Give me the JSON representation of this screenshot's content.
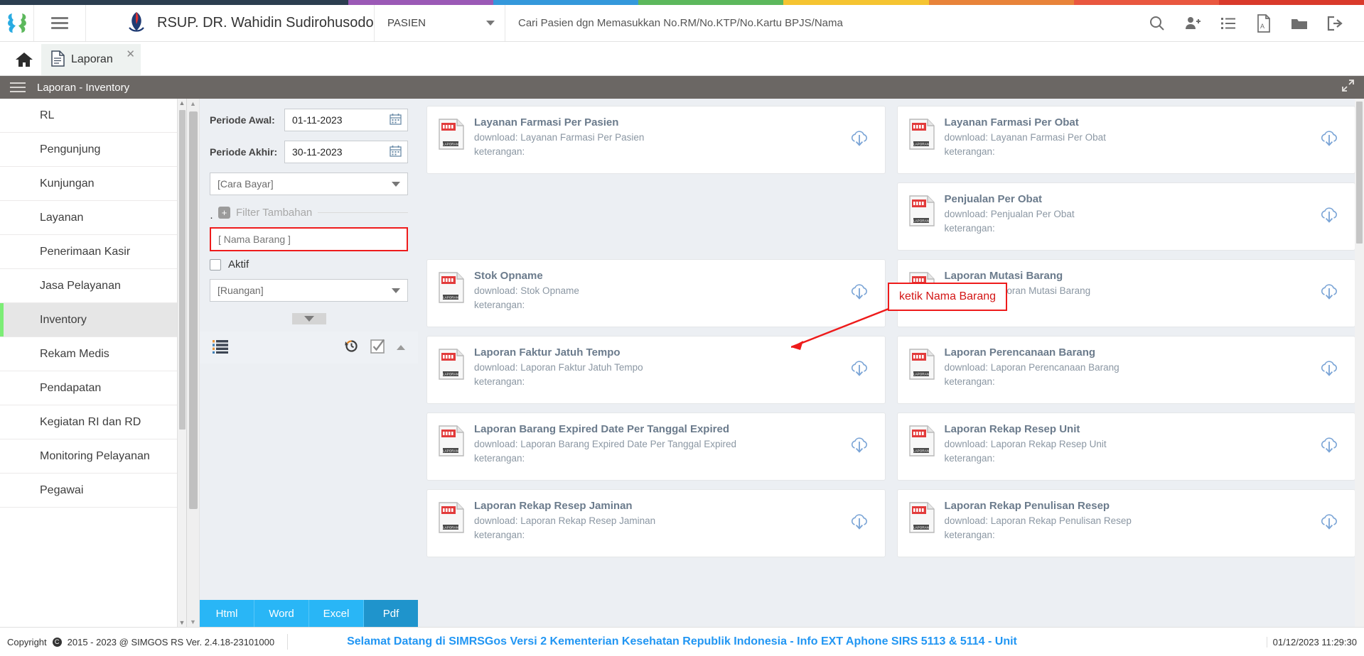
{
  "color_strip": [
    "#2c3e50",
    "#9b59b6",
    "#3498db",
    "#5cb85c",
    "#f5c431",
    "#e8833a",
    "#e9573f",
    "#d93a2b"
  ],
  "header": {
    "logo_icon": "simrs-logo-icon",
    "menu_icon": "hamburger-icon",
    "hospital_icon": "hospital-logo-icon",
    "hospital_name": "RSUP. DR. Wahidin Sudirohusodo",
    "category_select": "PASIEN",
    "search_placeholder": "Cari Pasien dgn Memasukkan No.RM/No.KTP/No.Kartu BPJS/Nama",
    "icons": [
      {
        "name": "search-icon",
        "label": "Cari"
      },
      {
        "name": "add-user-icon",
        "label": "Tambah Pasien"
      },
      {
        "name": "list-icon",
        "label": "Daftar"
      },
      {
        "name": "pdf-icon",
        "label": "PDF"
      },
      {
        "name": "folder-icon",
        "label": "Folder"
      },
      {
        "name": "logout-icon",
        "label": "Keluar"
      }
    ]
  },
  "tabstrip": {
    "home_icon": "home-icon",
    "tabs": [
      {
        "label": "Laporan",
        "icon": "document-icon",
        "close": "✕",
        "active": true
      }
    ]
  },
  "breadcrumb": {
    "menu_icon": "hamburger-icon",
    "title": "Laporan - Inventory",
    "expand_icon": "expand-arrows-icon"
  },
  "sidebar": {
    "items": [
      {
        "label": "RL",
        "active": false
      },
      {
        "label": "Pengunjung",
        "active": false
      },
      {
        "label": "Kunjungan",
        "active": false
      },
      {
        "label": "Layanan",
        "active": false
      },
      {
        "label": "Penerimaan Kasir",
        "active": false
      },
      {
        "label": "Jasa Pelayanan",
        "active": false
      },
      {
        "label": "Inventory",
        "active": true
      },
      {
        "label": "Rekam Medis",
        "active": false
      },
      {
        "label": "Pendapatan",
        "active": false
      },
      {
        "label": "Kegiatan RI dan RD",
        "active": false
      },
      {
        "label": "Monitoring Pelayanan",
        "active": false
      },
      {
        "label": "Pegawai",
        "active": false
      }
    ]
  },
  "filter": {
    "periode_awal_label": "Periode Awal:",
    "periode_awal_value": "01-11-2023",
    "periode_akhir_label": "Periode Akhir:",
    "periode_akhir_value": "30-11-2023",
    "calendar_icon": "calendar-icon",
    "cara_bayar": "[Cara Bayar]",
    "filter_tambahan": "Filter Tambahan",
    "plus_icon": "plus-square-icon",
    "nama_barang": "[ Nama Barang ]",
    "aktif_label": "Aktif",
    "aktif_checked": false,
    "ruangan": "[Ruangan]",
    "toolbar_icons": [
      {
        "name": "list-view-icon"
      },
      {
        "name": "history-reset-icon"
      },
      {
        "name": "check-square-icon"
      },
      {
        "name": "chevron-up-icon"
      }
    ],
    "buttons": [
      {
        "label": "Html",
        "active": false
      },
      {
        "label": "Word",
        "active": false
      },
      {
        "label": "Excel",
        "active": false
      },
      {
        "label": "Pdf",
        "active": true
      }
    ]
  },
  "annotation": {
    "text": "ketik Nama Barang",
    "color": "#d31616"
  },
  "reports": {
    "download_icon": "cloud-download-icon",
    "report_icon": "laporan-document-icon",
    "download_prefix": "download: ",
    "keterangan_label": "keterangan:",
    "items": [
      {
        "title": "Layanan Farmasi Per Pasien",
        "download": "download: Layanan Farmasi Per Pasien",
        "keterangan": "keterangan:"
      },
      {
        "title": "Layanan Farmasi Per Obat",
        "download": "download: Layanan Farmasi Per Obat",
        "keterangan": "keterangan:"
      },
      {
        "title": "",
        "download": "",
        "keterangan": "",
        "blank": true
      },
      {
        "title": "Penjualan Per Obat",
        "download": "download: Penjualan Per Obat",
        "keterangan": "keterangan:"
      },
      {
        "title": "Stok Opname",
        "download": "download: Stok Opname",
        "keterangan": "keterangan:"
      },
      {
        "title": "Laporan Mutasi Barang",
        "download": "download: Laporan Mutasi Barang",
        "keterangan": "keterangan:"
      },
      {
        "title": "Laporan Faktur Jatuh Tempo",
        "download": "download: Laporan Faktur Jatuh Tempo",
        "keterangan": "keterangan:"
      },
      {
        "title": "Laporan Perencanaan Barang",
        "download": "download: Laporan Perencanaan Barang",
        "keterangan": "keterangan:"
      },
      {
        "title": "Laporan Barang Expired Date Per Tanggal Expired",
        "download": "download: Laporan Barang Expired Date Per Tanggal Expired",
        "keterangan": "keterangan:"
      },
      {
        "title": "Laporan Rekap Resep Unit",
        "download": "download: Laporan Rekap Resep Unit",
        "keterangan": "keterangan:"
      },
      {
        "title": "Laporan Rekap Resep Jaminan",
        "download": "download: Laporan Rekap Resep Jaminan",
        "keterangan": "keterangan:"
      },
      {
        "title": "Laporan Rekap Penulisan Resep",
        "download": "download: Laporan Rekap Penulisan Resep",
        "keterangan": "keterangan:"
      }
    ]
  },
  "footer": {
    "copyright": "Copyright",
    "copyright_years": "2015 - 2023 @ SIMGOS RS Ver. 2.4.18-23101000",
    "marquee": "Selamat Datang di SIMRSGos Versi 2 Kementerian Kesehatan Republik Indonesia - Info EXT Aphone SIRS 5113 & 5114 - Unit",
    "datetime": "01/12/2023 11:29:30"
  }
}
